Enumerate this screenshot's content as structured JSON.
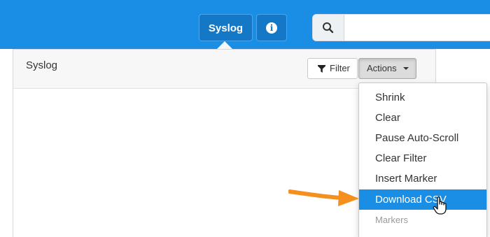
{
  "topbar": {
    "tabs": [
      {
        "label": "Syslog",
        "active": true
      },
      {
        "icon": "info-icon",
        "label": ""
      }
    ],
    "search": {
      "icon": "search-icon",
      "placeholder": "",
      "value": ""
    },
    "color": "#1a8ee4"
  },
  "panel": {
    "title": "Syslog",
    "filter_button": {
      "icon": "filter-icon",
      "label": "Filter"
    },
    "actions_button": {
      "label": "Actions",
      "icon": "caret-down-icon",
      "open": true
    }
  },
  "actions_menu": {
    "items": [
      {
        "label": "Shrink"
      },
      {
        "label": "Clear"
      },
      {
        "label": "Pause Auto-Scroll"
      },
      {
        "label": "Clear Filter"
      },
      {
        "label": "Insert Marker"
      },
      {
        "label": "Download CSV",
        "highlighted": true
      }
    ],
    "section_header": "Markers",
    "highlight_color": "#1a8ee4"
  },
  "annotation": {
    "arrow_color": "#f5901e",
    "icon": "hand-pointer-cursor-icon"
  }
}
